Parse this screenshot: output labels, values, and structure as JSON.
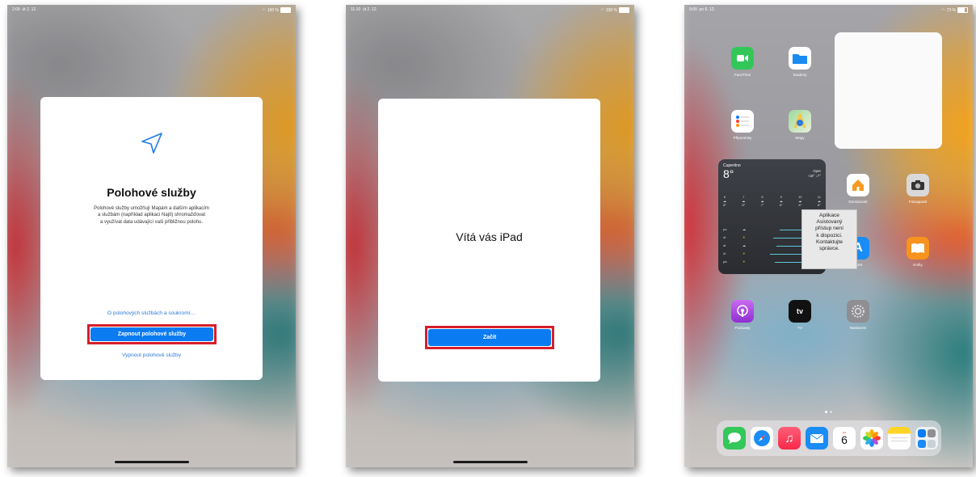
{
  "screen1": {
    "status": {
      "time": "2:09",
      "date": "út 2. 12.",
      "battery": "100 %"
    },
    "title": "Polohové služby",
    "description": [
      "Polohové služby umožňují Mapám a dalším aplikacím",
      "a službám (například aplikaci Najít) shromažďovat",
      "a využívat data udávající vaši přibližnou polohu."
    ],
    "privacy_link": "O polohových službách a soukromí…",
    "enable_button": "Zapnout polohové služby",
    "disable_link": "Vypnout polohové služby"
  },
  "screen2": {
    "status": {
      "time": "11:10",
      "date": "út 2. 12.",
      "battery": "100 %"
    },
    "title": "Vítá vás iPad",
    "start_button": "Začít"
  },
  "screen3": {
    "status": {
      "time": "9:09",
      "date": "po 6. 12.",
      "battery": "73 %"
    },
    "apps": {
      "facetime": "FaceTime",
      "files": "Soubory",
      "reminders": "Připomínky",
      "maps": "Mapy",
      "home": "Domácnost",
      "camera": "Fotoaparát",
      "appstore": "Store",
      "books": "Knihy",
      "podcasts": "Podcasty",
      "tv": "TV",
      "settings": "Nastavení"
    },
    "weather": {
      "city": "Cupertino",
      "temp": "8°",
      "condition": "Oper",
      "range": "↑18° ↓7°",
      "hours": [
        "6",
        "7",
        "8",
        "9",
        "10",
        "11"
      ],
      "hour_temps": [
        "8°",
        "8°",
        "7°",
        "8°",
        "8°",
        "8°"
      ],
      "days": [
        "po",
        "út",
        "st",
        "čt",
        "pá"
      ]
    },
    "tooltip": [
      "Aplikace",
      "Asistovaný",
      "přístup není",
      "k dispozici.",
      "Kontaktujte",
      "správce."
    ],
    "calendar": {
      "day_abbr": "po",
      "day_num": "6"
    }
  },
  "colors": {
    "accent": "#0b7bf2",
    "highlight": "#d81e2b",
    "link": "#2e7ad9"
  }
}
